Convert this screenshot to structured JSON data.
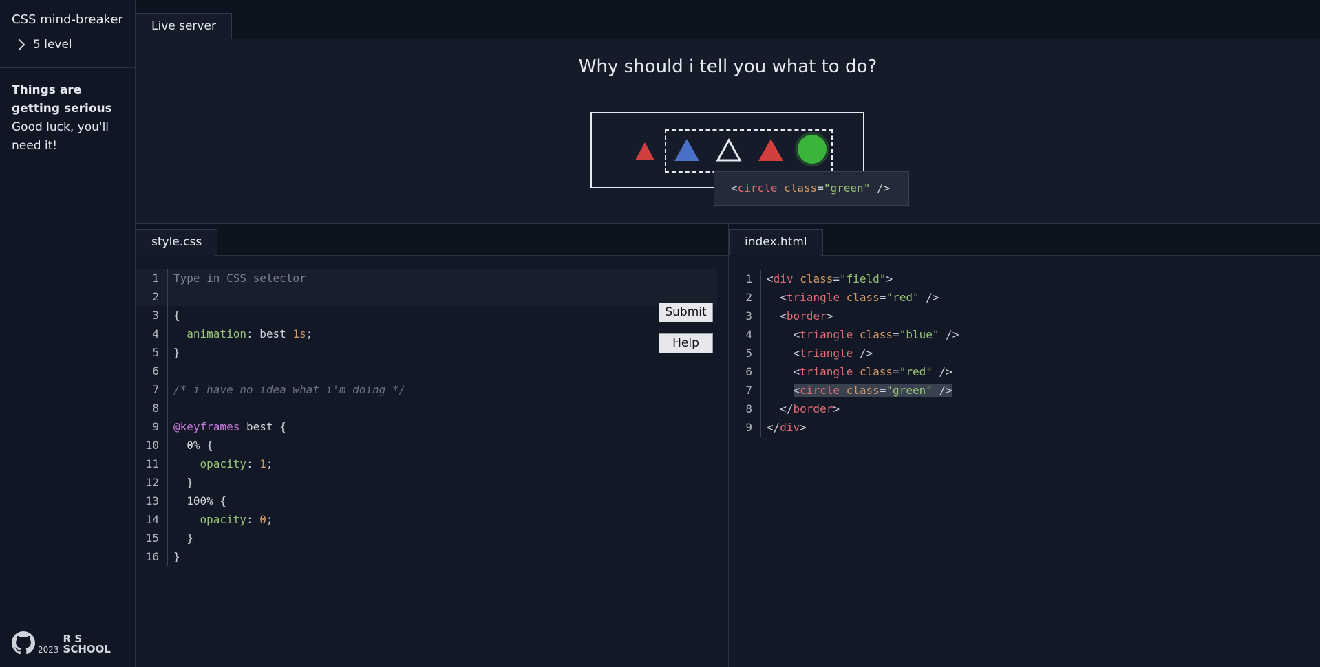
{
  "sidebar": {
    "brand": "CSS mind-breaker",
    "level": "5 level",
    "description_title": "Things are getting serious",
    "description_text": "Good luck, you'll need it!",
    "footer_year": "2023",
    "logo_text_1": "R S",
    "logo_text_2": "SCHOOL"
  },
  "live": {
    "tab_label": "Live server",
    "question": "Why should i tell you what to do?",
    "tooltip": "<circle class=\"green\" />"
  },
  "css_editor": {
    "tab_label": "style.css",
    "placeholder": "Type in CSS selector",
    "line_numbers": [
      "1",
      "2",
      "3",
      "4",
      "5",
      "6",
      "7",
      "8",
      "9",
      "10",
      "11",
      "12",
      "13",
      "14",
      "15",
      "16"
    ],
    "line3": "{",
    "line4_prop": "animation",
    "line4_value": "best",
    "line4_num": "1s",
    "line5": "}",
    "line7_comment": "/* i have no idea what i'm doing */",
    "line9_kw": "@keyframes",
    "line9_rest": "best {",
    "line10": "0% {",
    "line11_prop": "opacity",
    "line11_num": "1",
    "line12": "}",
    "line13": "100% {",
    "line14_prop": "opacity",
    "line14_num": "0",
    "line15": "}",
    "line16": "}",
    "submit_label": "Submit",
    "help_label": "Help"
  },
  "html_editor": {
    "tab_label": "index.html",
    "line_numbers": [
      "1",
      "2",
      "3",
      "4",
      "5",
      "6",
      "7",
      "8",
      "9"
    ],
    "tags": [
      "div",
      "triangle",
      "border",
      "triangle",
      "triangle",
      "triangle",
      "circle",
      "border",
      "div"
    ],
    "attr_name": "class",
    "values": [
      "\"field\"",
      "\"red\"",
      "\"blue\"",
      "\"red\"",
      "\"green\""
    ]
  },
  "colors": {
    "red": "#d23f3f",
    "blue": "#4a70c8",
    "green": "#3ab53a",
    "white": "#e6e9ef"
  }
}
